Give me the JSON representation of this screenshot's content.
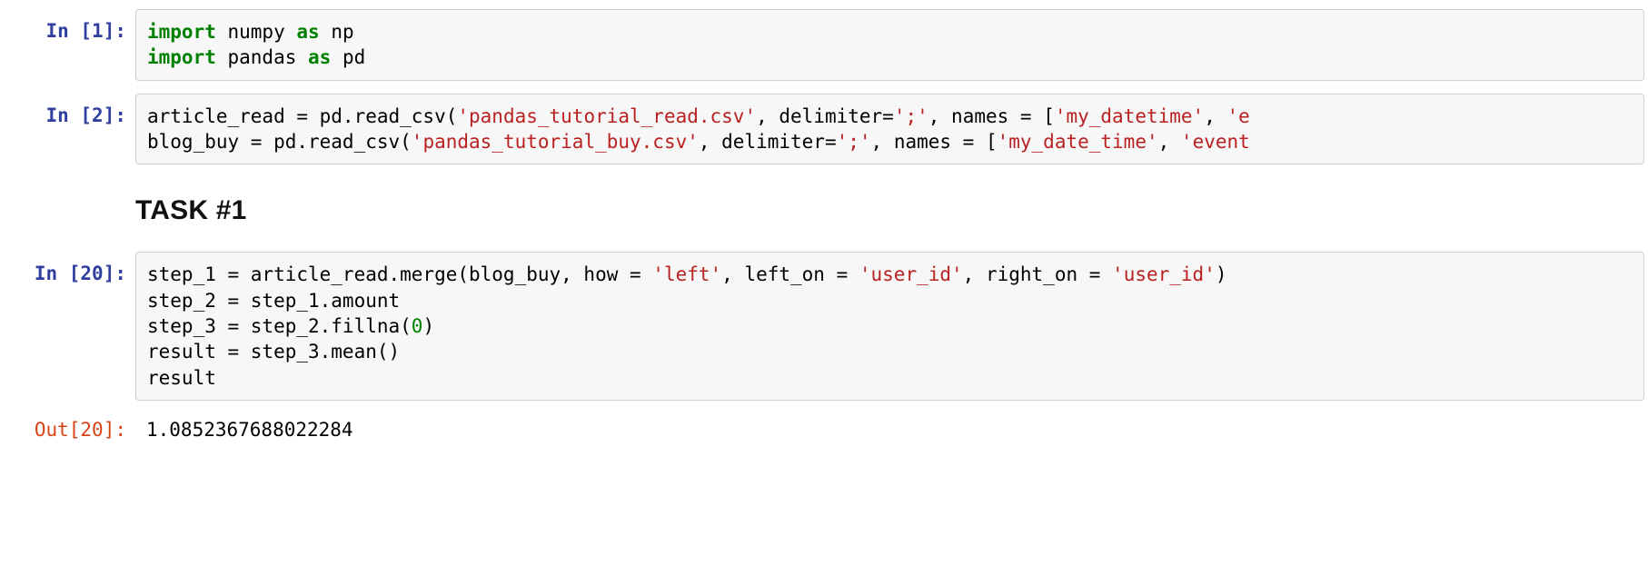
{
  "cells": {
    "c1": {
      "prompt_prefix": "In [",
      "prompt_num": "1",
      "prompt_suffix": "]:",
      "tokens": {
        "t0": "import",
        "t1": " numpy ",
        "t2": "as",
        "t3": " np",
        "t4": "\n",
        "t5": "import",
        "t6": " pandas ",
        "t7": "as",
        "t8": " pd"
      }
    },
    "c2": {
      "prompt_prefix": "In [",
      "prompt_num": "2",
      "prompt_suffix": "]:",
      "tokens": {
        "t0": "article_read = pd.read_csv(",
        "t1": "'pandas_tutorial_read.csv'",
        "t2": ", delimiter=",
        "t3": "';'",
        "t4": ", names = [",
        "t5": "'my_datetime'",
        "t6": ", ",
        "t7": "'e",
        "t8": "\n",
        "t9": "blog_buy = pd.read_csv(",
        "t10": "'pandas_tutorial_buy.csv'",
        "t11": ", delimiter=",
        "t12": "';'",
        "t13": ", names = [",
        "t14": "'my_date_time'",
        "t15": ", ",
        "t16": "'event"
      }
    },
    "md1": {
      "heading": "TASK #1"
    },
    "c3": {
      "prompt_prefix": "In [",
      "prompt_num": "20",
      "prompt_suffix": "]:",
      "tokens": {
        "t0": "step_1 = article_read.merge(blog_buy, how = ",
        "t1": "'left'",
        "t2": ", left_on = ",
        "t3": "'user_id'",
        "t4": ", right_on = ",
        "t5": "'user_id'",
        "t6": ")",
        "t7": "\n",
        "t8": "step_2 = step_1.amount",
        "t9": "\n",
        "t10": "step_3 = step_2.fillna(",
        "t11": "0",
        "t12": ")",
        "t13": "\n",
        "t14": "result = step_3.mean()",
        "t15": "\n",
        "t16": "result"
      }
    },
    "o3": {
      "prompt_prefix": "Out[",
      "prompt_num": "20",
      "prompt_suffix": "]:",
      "value": "1.0852367688022284"
    }
  }
}
